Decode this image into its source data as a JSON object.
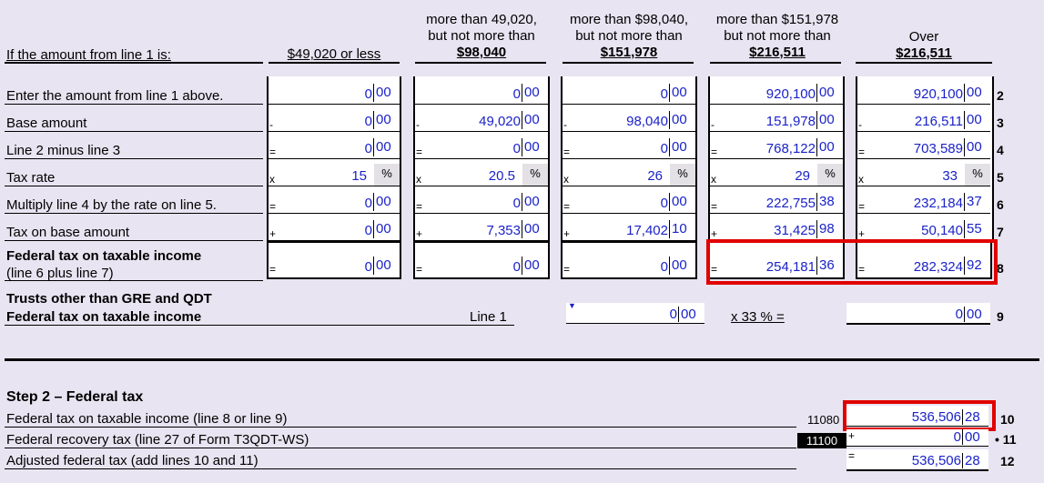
{
  "header": {
    "intro": "If the amount from line 1 is:",
    "col1": {
      "line1": "$49,020 or less"
    },
    "col2": {
      "line1": "more than 49,020,",
      "line2": "but not more than",
      "line3": "$98,040"
    },
    "col3": {
      "line1": "more than $98,040,",
      "line2": "but not more than",
      "line3": "$151,978"
    },
    "col4": {
      "line1": "more than $151,978",
      "line2": "but not more than",
      "line3": "$216,511"
    },
    "col5": {
      "line1": "Over",
      "line2": "$216,511"
    }
  },
  "rows": {
    "r2": {
      "label": "Enter the amount from line 1 above.",
      "num": "2",
      "op": ""
    },
    "r3": {
      "label": "Base amount",
      "num": "3",
      "op": "-"
    },
    "r4": {
      "label": "Line 2 minus line 3",
      "num": "4",
      "op": "="
    },
    "r5": {
      "label": "Tax rate",
      "num": "5",
      "op": "x",
      "pct": "%"
    },
    "r6": {
      "label": "Multiply line 4 by the rate on line 5.",
      "num": "6",
      "op": "="
    },
    "r7": {
      "label": "Tax on base amount",
      "num": "7",
      "op": "+"
    },
    "r8": {
      "label": "Federal tax on taxable income",
      "sublabel": "(line 6 plus line 7)",
      "num": "8",
      "op": "="
    }
  },
  "values": {
    "c1": {
      "r2": [
        "0",
        "00"
      ],
      "r3": [
        "0",
        "00"
      ],
      "r4": [
        "0",
        "00"
      ],
      "r5": "15",
      "r6": [
        "0",
        "00"
      ],
      "r7": [
        "0",
        "00"
      ],
      "r8": [
        "0",
        "00"
      ]
    },
    "c2": {
      "r2": [
        "0",
        "00"
      ],
      "r3": [
        "49,020",
        "00"
      ],
      "r4": [
        "0",
        "00"
      ],
      "r5": "20.5",
      "r6": [
        "0",
        "00"
      ],
      "r7": [
        "7,353",
        "00"
      ],
      "r8": [
        "0",
        "00"
      ]
    },
    "c3": {
      "r2": [
        "0",
        "00"
      ],
      "r3": [
        "98,040",
        "00"
      ],
      "r4": [
        "0",
        "00"
      ],
      "r5": "26",
      "r6": [
        "0",
        "00"
      ],
      "r7": [
        "17,402",
        "10"
      ],
      "r8": [
        "0",
        "00"
      ]
    },
    "c4": {
      "r2": [
        "920,100",
        "00"
      ],
      "r3": [
        "151,978",
        "00"
      ],
      "r4": [
        "768,122",
        "00"
      ],
      "r5": "29",
      "r6": [
        "222,755",
        "38"
      ],
      "r7": [
        "31,425",
        "98"
      ],
      "r8": [
        "254,181",
        "36"
      ]
    },
    "c5": {
      "r2": [
        "920,100",
        "00"
      ],
      "r3": [
        "216,511",
        "00"
      ],
      "r4": [
        "703,589",
        "00"
      ],
      "r5": "33",
      "r6": [
        "232,184",
        "37"
      ],
      "r7": [
        "50,140",
        "55"
      ],
      "r8": [
        "282,324",
        "92"
      ]
    }
  },
  "trusts": {
    "label1": "Trusts other than GRE and QDT",
    "label2": "Federal tax on taxable income",
    "line1_label": "Line 1",
    "input": [
      "0",
      "00"
    ],
    "multiplier": "x 33 % =",
    "result": [
      "0",
      "00"
    ],
    "num": "9"
  },
  "step2": {
    "title": "Step 2 – Federal tax",
    "l10": {
      "label": "Federal tax on taxable income (line 8 or line 9)",
      "code": "11080",
      "value": [
        "536,506",
        "28"
      ],
      "num": "10"
    },
    "l11": {
      "label": "Federal recovery tax (line 27 of Form T3QDT-WS)",
      "code": "11100",
      "op": "+",
      "value": [
        "0",
        "00"
      ],
      "num": "• 11"
    },
    "l12": {
      "label": "Adjusted federal tax (add lines 10 and 11)",
      "op": "=",
      "value": [
        "536,506",
        "28"
      ],
      "num": "12"
    }
  },
  "colors": {
    "highlight": "#e10000",
    "value_text": "#1a22c8"
  }
}
